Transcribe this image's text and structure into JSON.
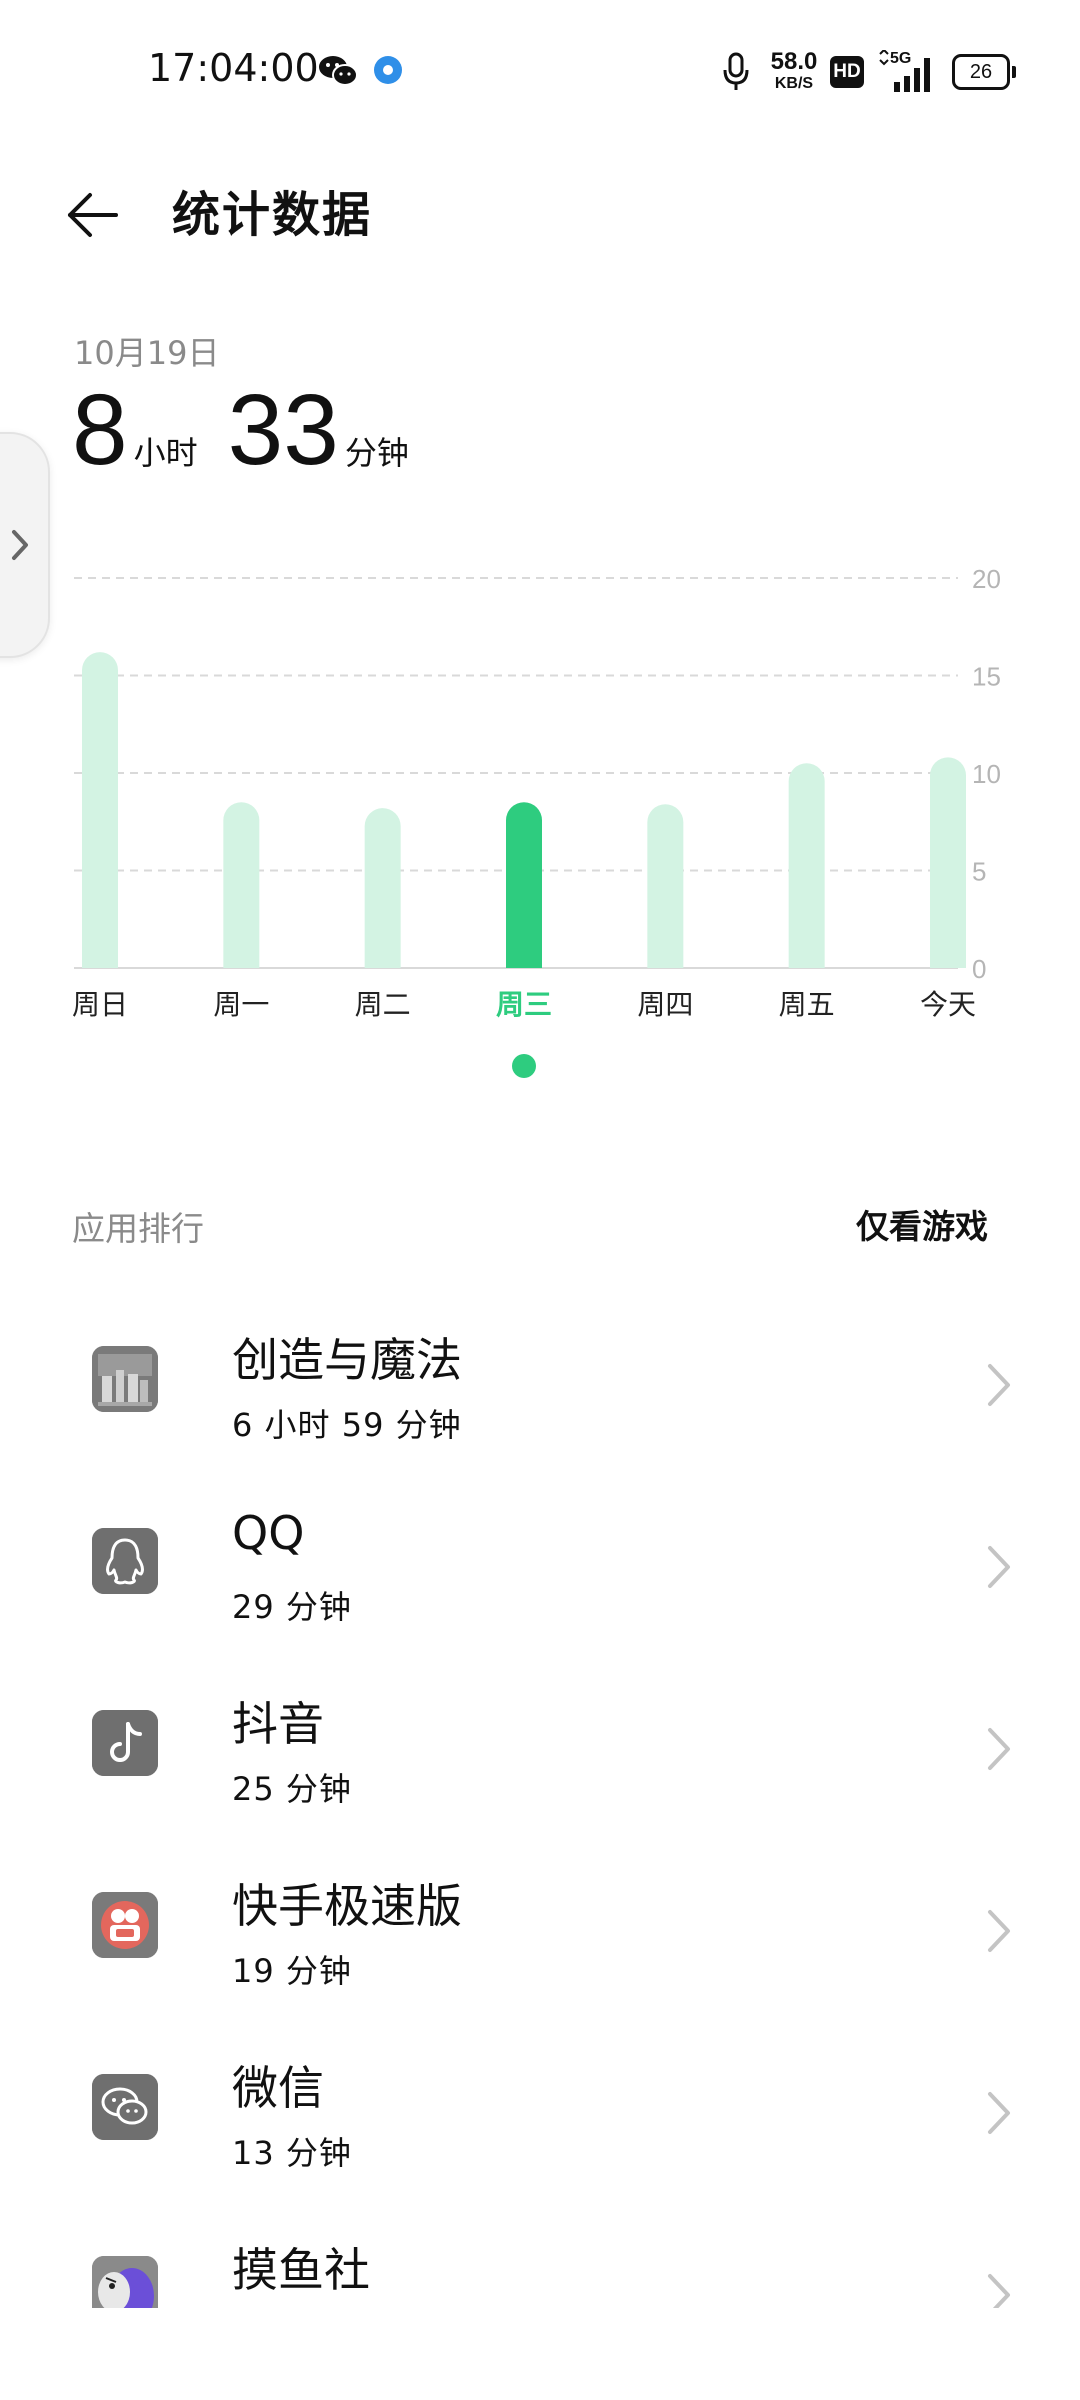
{
  "status_bar": {
    "time": "17:04:00",
    "net_speed_value": "58.0",
    "net_speed_unit": "KB/S",
    "hd_label": "HD",
    "network_type": "5G",
    "battery_level": "26"
  },
  "header": {
    "title": "统计数据"
  },
  "summary": {
    "date": "10月19日",
    "hours": "8",
    "hours_unit": "小时",
    "minutes": "33",
    "minutes_unit": "分钟"
  },
  "chart_data": {
    "type": "bar",
    "categories": [
      "周日",
      "周一",
      "周二",
      "周三",
      "周四",
      "周五",
      "今天"
    ],
    "values": [
      16.2,
      8.5,
      8.2,
      8.5,
      8.4,
      10.5,
      10.8
    ],
    "selected_index": 3,
    "y_ticks": [
      "0",
      "5",
      "10",
      "15",
      "20"
    ],
    "ylim": [
      0,
      20
    ],
    "grid": true,
    "colors": {
      "bar": "#d3f3e3",
      "bar_selected": "#2ecc7f",
      "label_selected": "#2ecc7f",
      "grid": "#d9d9d9",
      "tick": "#b5b5b5"
    }
  },
  "rankings": {
    "title": "应用排行",
    "games_only_label": "仅看游戏",
    "apps": [
      {
        "name": "创造与魔法",
        "time": "6 小时 59 分钟",
        "icon": "game-icon"
      },
      {
        "name": "QQ",
        "time": "29 分钟",
        "icon": "qq-icon"
      },
      {
        "name": "抖音",
        "time": "25 分钟",
        "icon": "douyin-icon"
      },
      {
        "name": "快手极速版",
        "time": "19 分钟",
        "icon": "kuaishou-icon"
      },
      {
        "name": "微信",
        "time": "13 分钟",
        "icon": "wechat-icon"
      },
      {
        "name": "摸鱼社",
        "time": "",
        "icon": "moyushe-icon"
      }
    ]
  }
}
